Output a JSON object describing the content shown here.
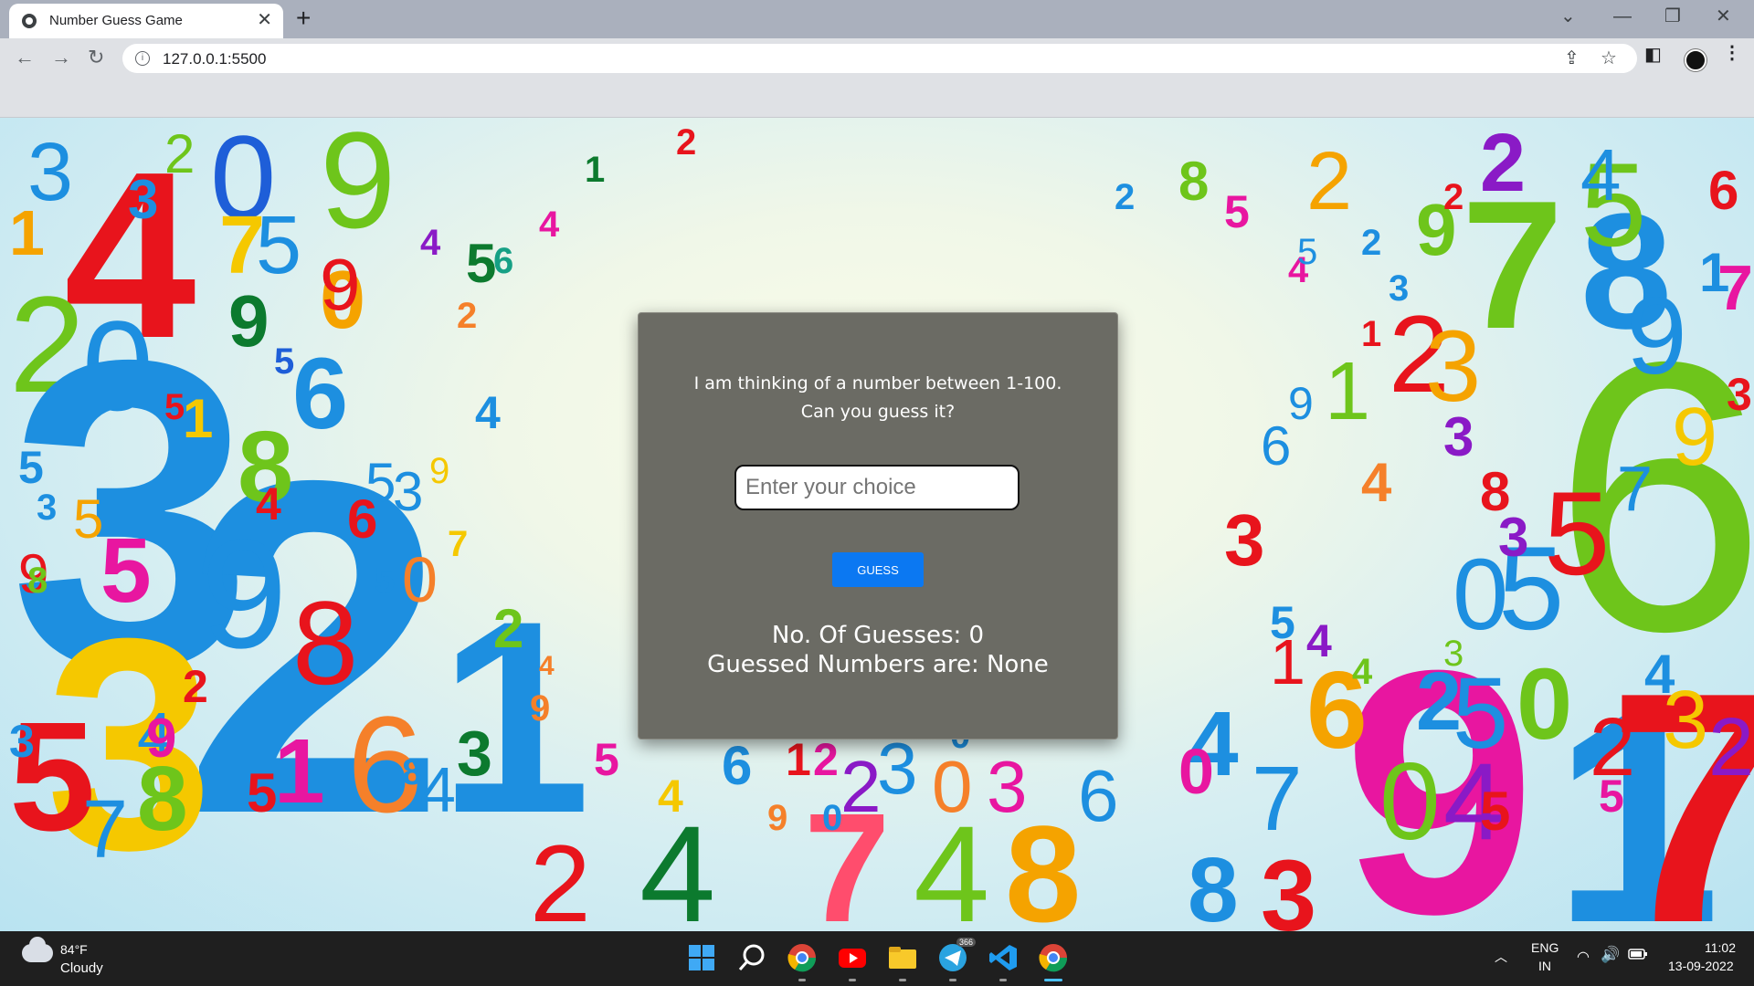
{
  "browser": {
    "tab_title": "Number Guess Game",
    "tab_close": "✕",
    "new_tab": "+",
    "url": "127.0.0.1:5500",
    "controls": {
      "tab_search": "⌄",
      "minimize": "—",
      "restore": "❐",
      "close": "✕"
    },
    "nav": {
      "back": "←",
      "forward": "→",
      "reload": "↻"
    }
  },
  "game": {
    "prompt_line1": "I am thinking of a number between 1-100.",
    "prompt_line2": "Can you guess it?",
    "input_placeholder": "Enter your choice",
    "input_value": "",
    "guess_button": "GUESS",
    "guesses_text": "No. Of Guesses: 0",
    "guessed_numbers_text": "Guessed Numbers are: None"
  },
  "taskbar": {
    "weather_temp": "84°F",
    "weather_desc": "Cloudy",
    "language": "ENG",
    "region": "IN",
    "time": "11:02",
    "date": "13-09-2022",
    "telegram_badge": "366"
  }
}
